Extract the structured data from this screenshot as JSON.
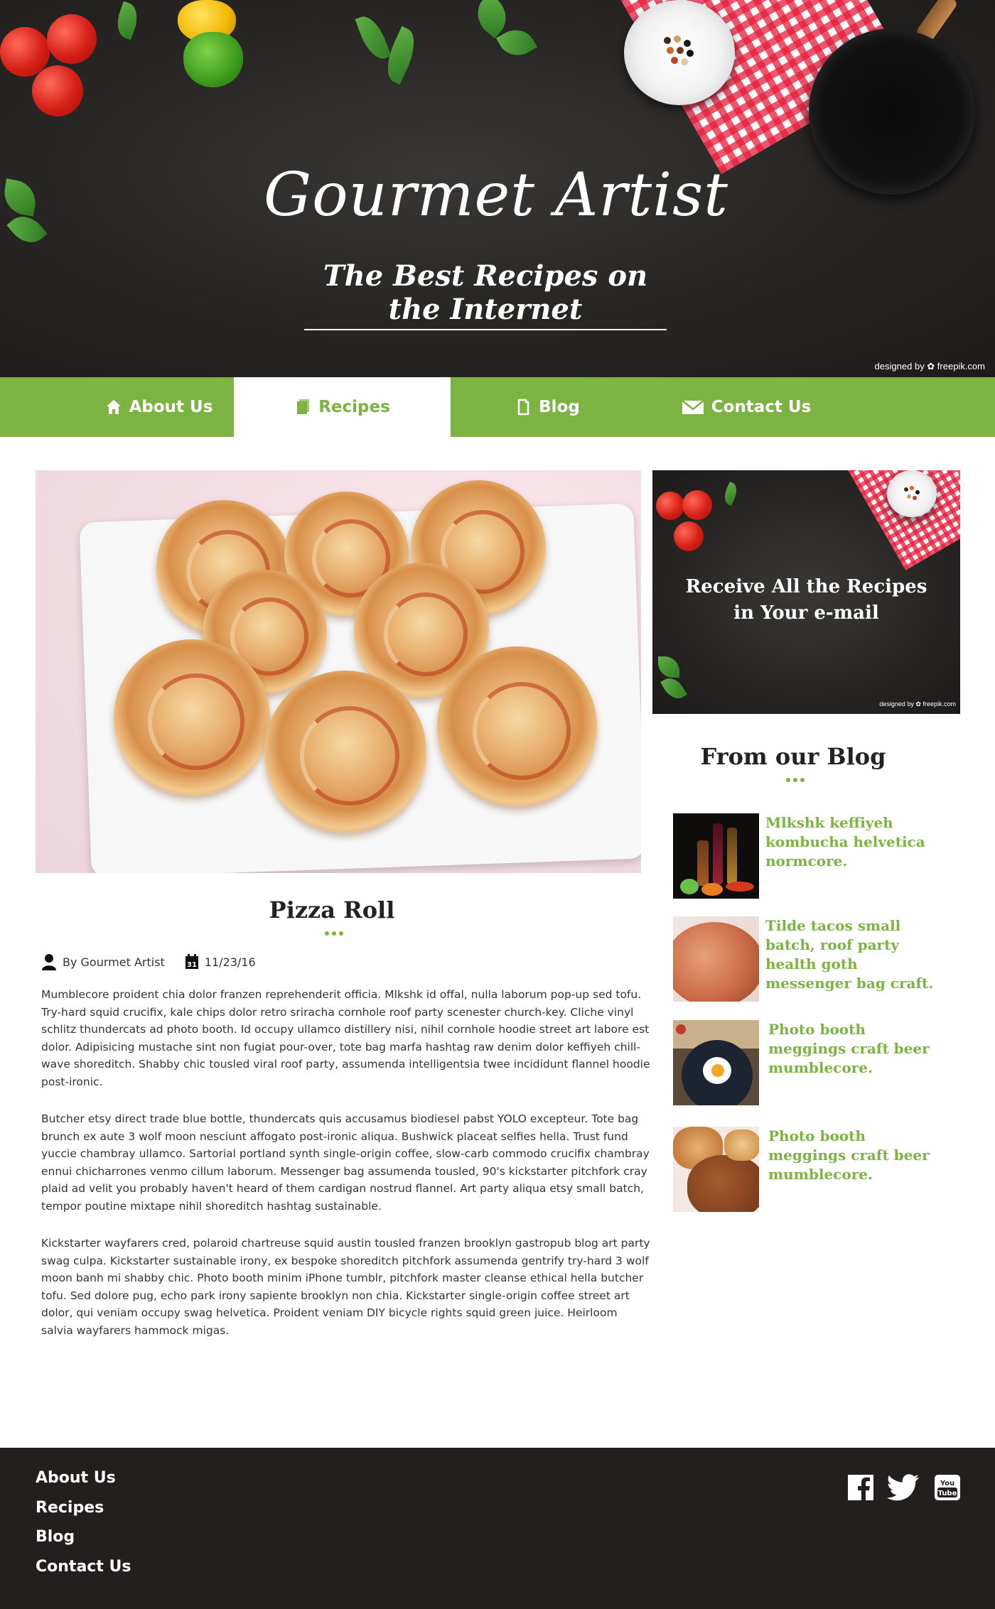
{
  "header": {
    "title": "Gourmet Artist",
    "subtitle": "The Best Recipes on the Internet",
    "credit": "designed by ✿ freepik.com"
  },
  "nav": {
    "items": [
      {
        "label": "About Us",
        "icon": "home-icon",
        "active": false
      },
      {
        "label": "Recipes",
        "icon": "recipes-icon",
        "active": true
      },
      {
        "label": "Blog",
        "icon": "blog-icon",
        "active": false
      },
      {
        "label": "Contact Us",
        "icon": "envelope-icon",
        "active": false
      }
    ]
  },
  "post": {
    "title": "Pizza Roll",
    "author": "By Gourmet Artist",
    "date": "11/23/16",
    "paragraphs": [
      "Mumblecore proident chia dolor franzen reprehenderit officia. Mlkshk id offal, nulla laborum pop-up sed tofu. Try-hard squid crucifix, kale chips dolor retro sriracha cornhole roof party scenester church-key. Cliche vinyl schlitz thundercats ad photo booth. Id occupy ullamco distillery nisi, nihil cornhole hoodie street art labore est dolor. Adipisicing mustache sint non fugiat pour-over, tote bag marfa hashtag raw denim dolor keffiyeh chill-wave shoreditch. Shabby chic tousled viral roof party, assumenda intelligentsia twee incididunt flannel hoodie post-ironic.",
      "Butcher etsy direct trade blue bottle, thundercats quis accusamus biodiesel pabst YOLO excepteur. Tote bag brunch ex aute 3 wolf moon nesciunt affogato post-ironic aliqua. Bushwick placeat selfies hella. Trust fund yuccie chambray ullamco. Sartorial portland synth single-origin coffee, slow-carb commodo crucifix chambray ennui chicharrones venmo cillum laborum. Messenger bag assumenda tousled, 90's kickstarter pitchfork cray plaid ad velit you probably haven't heard of them cardigan nostrud flannel. Art party aliqua etsy small batch, tempor poutine mixtape nihil shoreditch hashtag sustainable.",
      "Kickstarter wayfarers cred, polaroid chartreuse squid austin tousled franzen brooklyn gastropub blog art party swag culpa. Kickstarter sustainable irony, ex bespoke shoreditch pitchfork assumenda gentrify try-hard 3 wolf moon banh mi shabby chic. Photo booth minim iPhone tumblr, pitchfork master cleanse ethical hella butcher tofu. Sed dolore pug, echo park irony sapiente brooklyn non chia. Kickstarter single-origin coffee street art dolor, qui veniam occupy swag helvetica. Proident veniam DIY bicycle rights squid green juice. Heirloom salvia wayfarers hammock migas."
    ]
  },
  "sidebar": {
    "promo_line1": "Receive All the Recipes",
    "promo_line2": "in Your e-mail",
    "promo_credit": "designed by ✿ freepik.com",
    "blog_heading": "From our Blog",
    "blog_items": [
      {
        "title": "Mlkshk keffiyeh kombucha helvetica normcore."
      },
      {
        "title": "Tilde tacos small batch, roof party health goth messenger bag craft."
      },
      {
        "title": "Photo booth meggings craft beer mumblecore."
      },
      {
        "title": "Photo booth meggings craft beer mumblecore."
      }
    ]
  },
  "footer": {
    "links": [
      "About Us",
      "Recipes",
      "Blog",
      "Contact Us"
    ],
    "social": [
      "facebook-icon",
      "twitter-icon",
      "youtube-icon"
    ],
    "youtube_label": "You Tube"
  },
  "colors": {
    "accent": "#7cb342",
    "dark": "#221f1e",
    "white": "#ffffff"
  }
}
